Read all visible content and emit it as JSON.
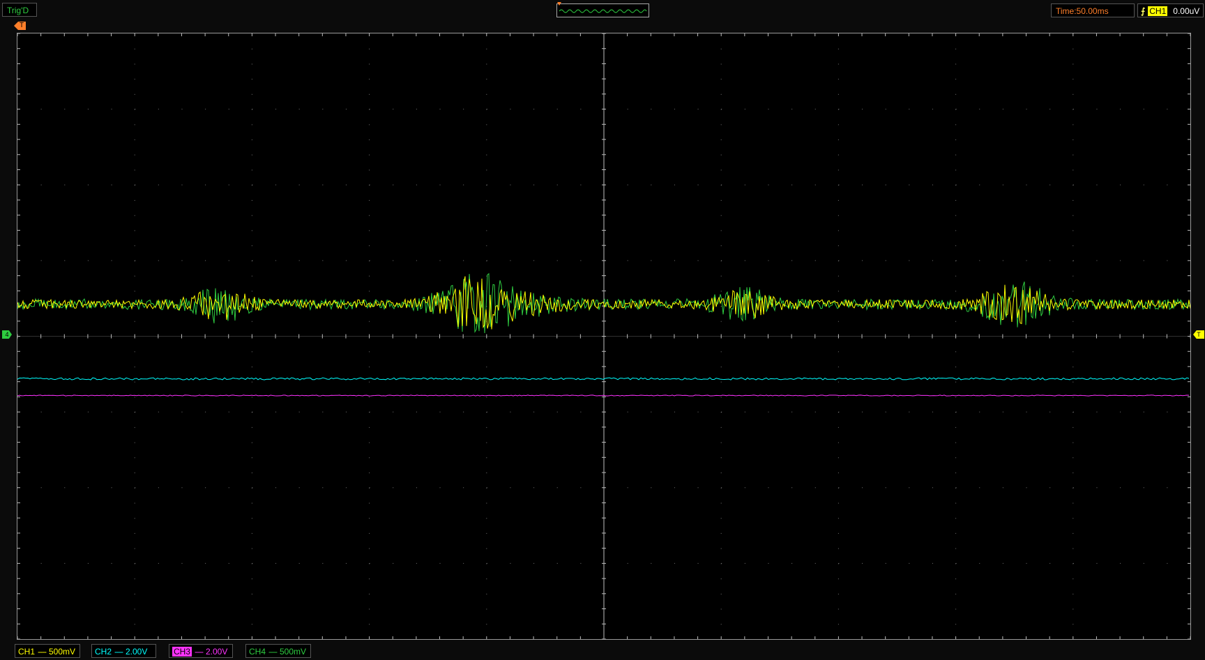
{
  "app": {
    "trig_status": "Trig'D",
    "timebase": "Time:50.00ms",
    "trigger": {
      "source": "CH1",
      "level": "0.00uV",
      "edge_icon": "rising-edge-icon"
    },
    "trigger_pos_label": "T",
    "level_marker_left": "4",
    "level_marker_right": "T"
  },
  "colors": {
    "ch1": "#ffff00",
    "ch2": "#00ffff",
    "ch3": "#ff33ff",
    "ch4": "#2ecc40",
    "accent": "#ff7f2a",
    "grid": "#bfbfbf"
  },
  "channels": [
    {
      "label": "CH1",
      "coupling": "----",
      "scale": "500mV",
      "color": "#ffff00"
    },
    {
      "label": "CH2",
      "coupling": "----",
      "scale": "2.00V",
      "color": "#00ffff"
    },
    {
      "label": "CH3",
      "coupling": "----",
      "scale": "2.00V",
      "color": "#ff33ff"
    },
    {
      "label": "CH4",
      "coupling": "----",
      "scale": "500mV",
      "color": "#2ecc40"
    }
  ],
  "grid": {
    "h_divs": 10,
    "v_divs": 8
  }
}
